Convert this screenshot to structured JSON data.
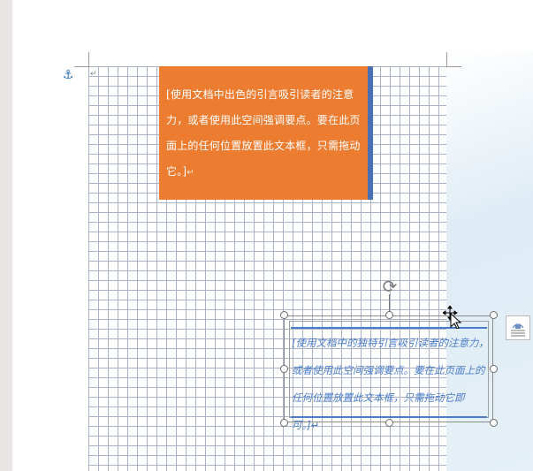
{
  "quote_box": {
    "text": "[使用文档中出色的引言吸引读者的注意力，或者使用此空间强调要点。要在此页面上的任何位置放置此文本框，只需拖动它。]",
    "paragraph_mark": "↵",
    "fill_color": "#ec7c30",
    "accent_bar_color": "#4b6fb4"
  },
  "selected_box": {
    "text": "[使用文档中的独特引言吸引读者的注意力，或者使用此空间强调要点。要在此页面上的任何位置放置此文本框，只需拖动它即可。]",
    "paragraph_mark": "↵",
    "text_color": "#4a7cc9",
    "border_line_color": "#4a7cc9"
  },
  "page": {
    "top_paragraph_mark": "↵",
    "anchor_icon": "⚓",
    "gridline_color": "#a9b2c7"
  },
  "icons": {
    "rotate": "⟳",
    "layout_options": "layout-options-icon",
    "move_cursor": "move-cursor-icon"
  }
}
